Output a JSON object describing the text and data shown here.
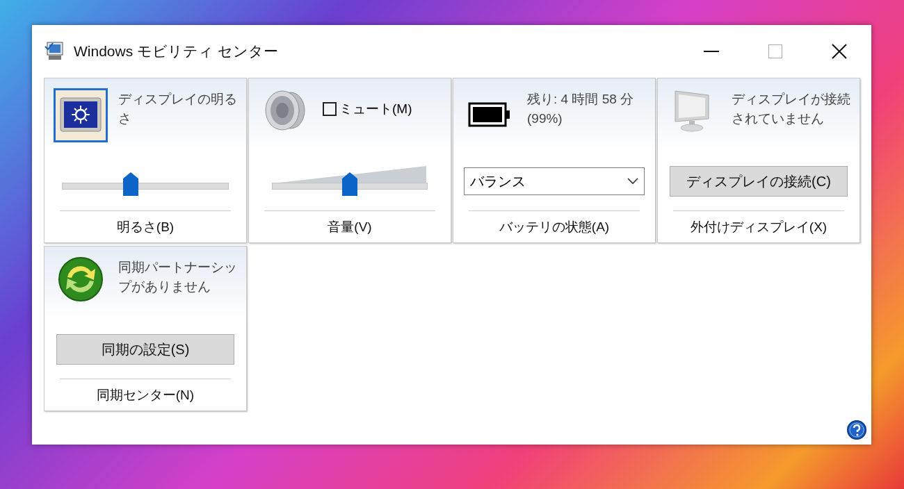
{
  "window": {
    "title": "Windows モビリティ センター"
  },
  "tiles": [
    {
      "kind": "brightness",
      "status": "ディスプレイの明るさ",
      "level": 0.41,
      "label": "明るさ(B)"
    },
    {
      "kind": "volume",
      "mute_label": "ミュート(M)",
      "muted": false,
      "level": 0.5,
      "label": "音量(V)"
    },
    {
      "kind": "battery",
      "status": "残り: 4 時間 58 分 (99%)",
      "plan": "バランス",
      "label": "バッテリの状態(A)"
    },
    {
      "kind": "display",
      "status": "ディスプレイが接続されていません",
      "button": "ディスプレイの接続(C)",
      "label": "外付けディスプレイ(X)"
    },
    {
      "kind": "sync",
      "status": "同期パートナーシップがありません",
      "button": "同期の設定(S)",
      "label": "同期センター(N)"
    }
  ]
}
